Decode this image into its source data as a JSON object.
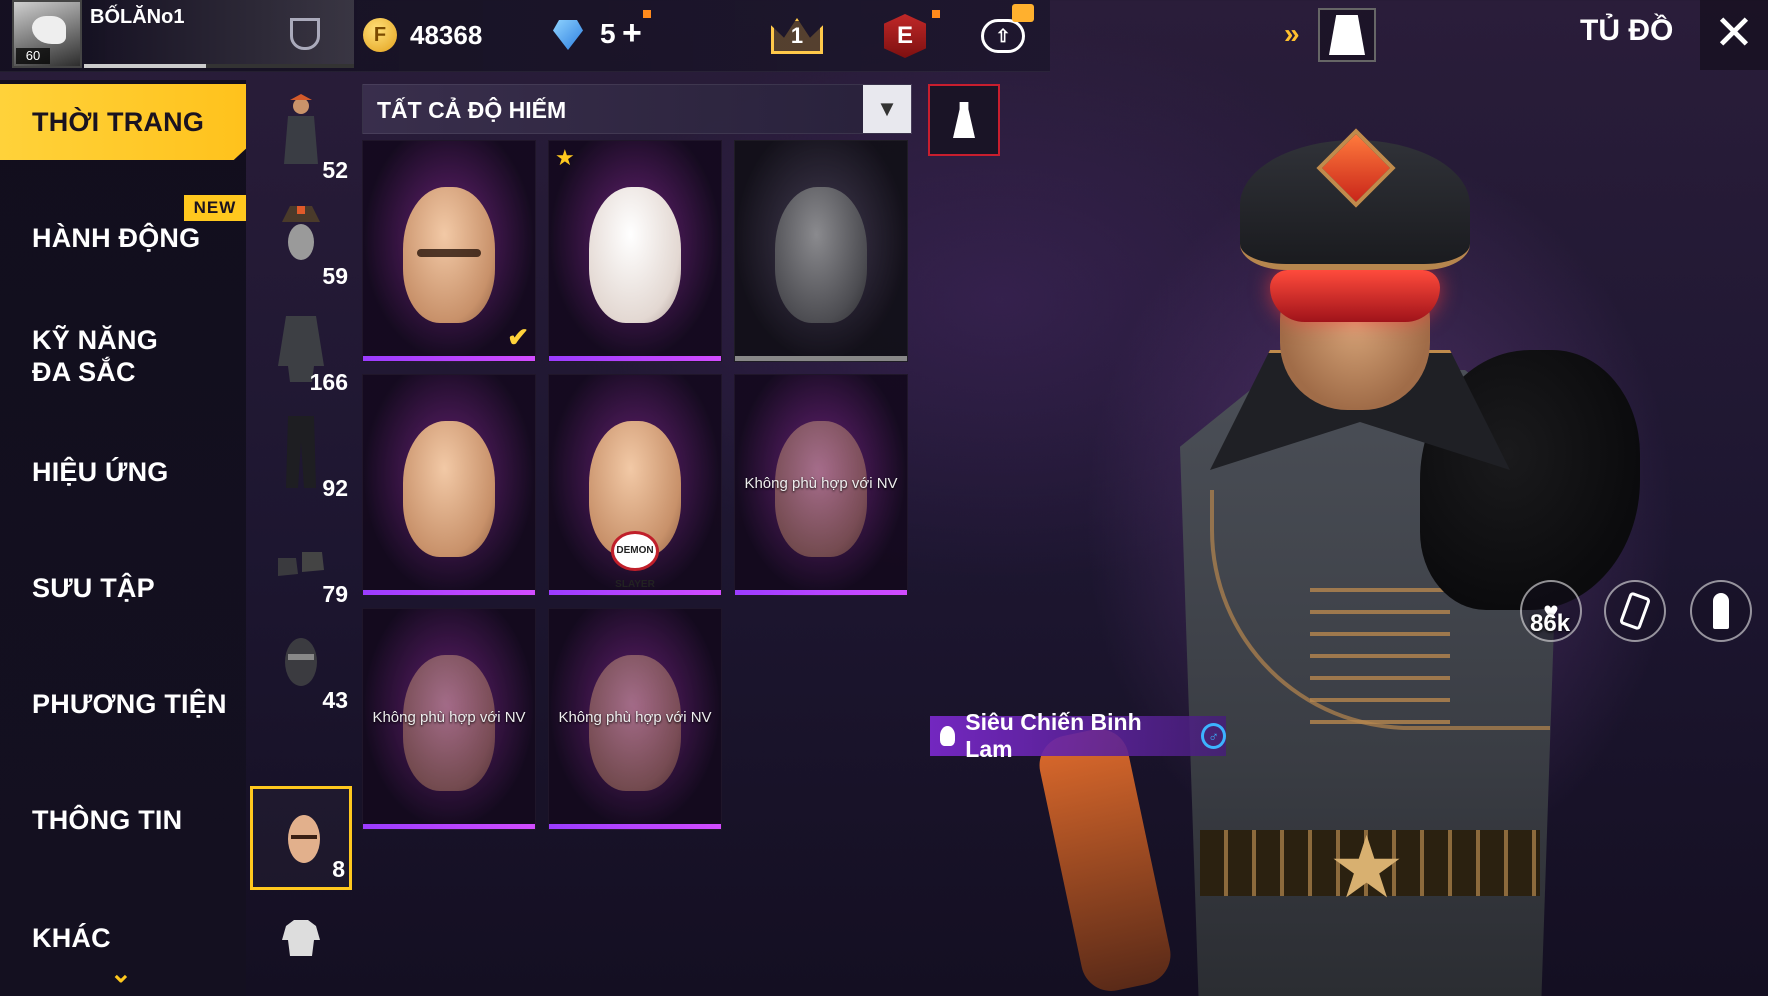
{
  "topbar": {
    "player_name": "BỐLĂNo1",
    "level": "60",
    "gold": "48368",
    "diamonds": "5",
    "diamond_plus": "+",
    "crown_rank": "1",
    "elite_label": "E",
    "title": "TỦ ĐỒ",
    "close": "✕",
    "double_arrow": "»"
  },
  "sidebar": {
    "items": [
      {
        "label": "THỜI TRANG"
      },
      {
        "label": "HÀNH ĐỘNG"
      },
      {
        "label": "KỸ NĂNG ĐA SẮC"
      },
      {
        "label": "HIỆU ỨNG"
      },
      {
        "label": "SƯU TẬP"
      },
      {
        "label": "PHƯƠNG TIỆN"
      },
      {
        "label": "THÔNG TIN"
      },
      {
        "label": "KHÁC"
      }
    ],
    "new_badge": "NEW"
  },
  "categories": [
    {
      "count": "52"
    },
    {
      "count": "59"
    },
    {
      "count": "166"
    },
    {
      "count": "92"
    },
    {
      "count": "79"
    },
    {
      "count": "43"
    },
    {
      "count": "8"
    },
    {
      "count": ""
    }
  ],
  "filter": {
    "selected": "TẤT CẢ ĐỘ HIẾM"
  },
  "grid": {
    "unsuitable_label": "Không phù hợp với NV",
    "emblem_text": "DEMON SLAYER"
  },
  "character": {
    "name": "Siêu Chiến Binh Lam",
    "gender_icon": "♂"
  },
  "tools": {
    "likes": "86k"
  },
  "colors": {
    "accent": "#ffc81e",
    "rarity_purple": "#b44cff",
    "danger_red": "#c81e2e"
  }
}
